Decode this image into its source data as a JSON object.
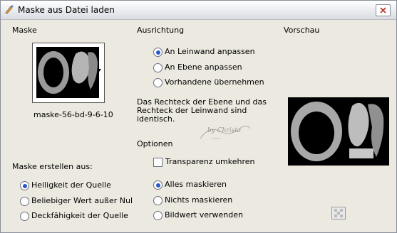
{
  "window": {
    "title": "Maske aus Datei laden"
  },
  "mask": {
    "group_label": "Maske",
    "name": "maske-56-bd-9-6-10"
  },
  "create_from": {
    "group_label": "Maske erstellen aus:",
    "options": [
      {
        "label": "Helligkeit der Quelle",
        "selected": true
      },
      {
        "label": "Beliebiger Wert außer Null",
        "selected": false
      },
      {
        "label": "Deckfähigkeit der Quelle",
        "selected": false
      }
    ]
  },
  "alignment": {
    "group_label": "Ausrichtung",
    "options": [
      {
        "label": "An Leinwand anpassen",
        "selected": true
      },
      {
        "label": "An Ebene anpassen",
        "selected": false
      },
      {
        "label": "Vorhandene übernehmen",
        "selected": false
      }
    ],
    "description_line1": "Das Rechteck der Ebene und das",
    "description_line2": "Rechteck der Leinwand sind",
    "description_line3": "identisch."
  },
  "options": {
    "group_label": "Optionen",
    "invert_label": "Transparenz umkehren",
    "invert_checked": false,
    "mask_options": [
      {
        "label": "Alles maskieren",
        "selected": true
      },
      {
        "label": "Nichts maskieren",
        "selected": false
      },
      {
        "label": "Bildwert verwenden",
        "selected": false
      }
    ]
  },
  "preview": {
    "group_label": "Vorschau"
  },
  "watermark": "by Christa",
  "icons": {
    "title": "paint-brush-icon",
    "close": "close-icon",
    "refresh": "checkerboard-icon"
  }
}
